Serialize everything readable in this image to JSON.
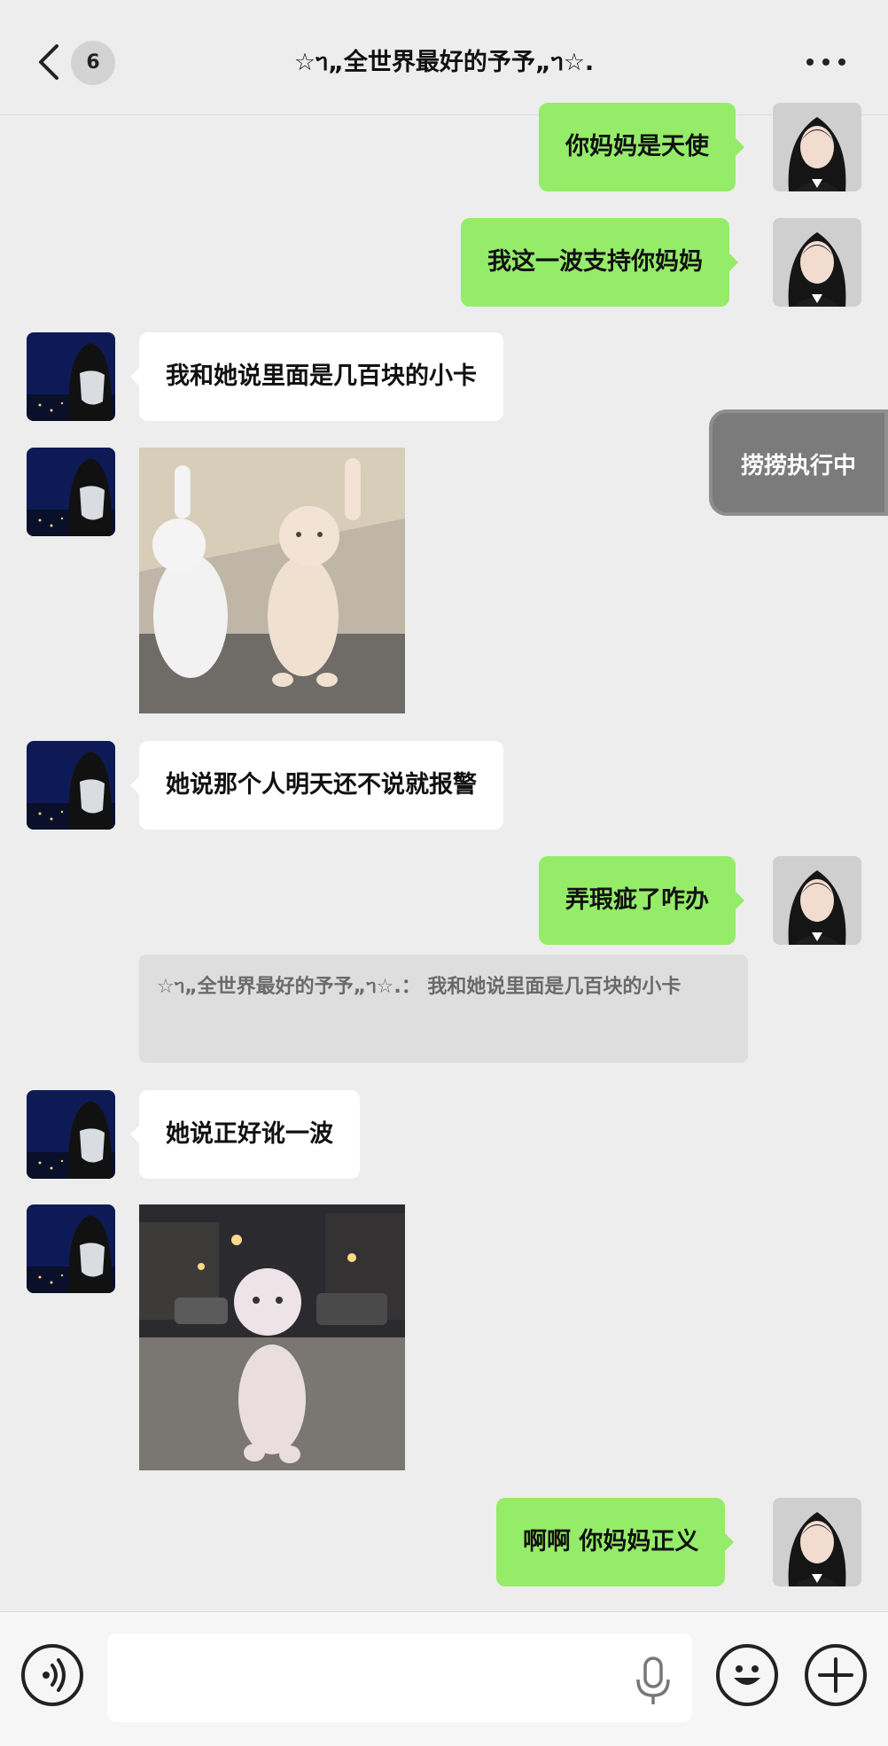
{
  "header": {
    "unread_count": "6",
    "title": "☆ᥐ„全世界最好的予予„ᥐ☆."
  },
  "messages": [
    {
      "side": "out",
      "type": "text",
      "text": "你妈妈是天使"
    },
    {
      "side": "out",
      "type": "text",
      "text": "我这一波支持你妈妈"
    },
    {
      "side": "in",
      "type": "text",
      "text": "我和她说里面是几百块的小卡"
    },
    {
      "side": "in",
      "type": "sticker",
      "sticker": "two-kittens-waving"
    },
    {
      "side": "in",
      "type": "text",
      "text": "她说那个人明天还不说就报警"
    },
    {
      "side": "out",
      "type": "text",
      "text": "弄瑕疵了咋办"
    },
    {
      "side": "in",
      "type": "quote",
      "text": "☆ᥐ„全世界最好的予予„ᥐ☆.： 我和她说里面是几百块的小卡"
    },
    {
      "side": "in",
      "type": "text",
      "text": "她说正好讹一波"
    },
    {
      "side": "in",
      "type": "sticker",
      "sticker": "kitten-walking-street"
    },
    {
      "side": "out",
      "type": "text",
      "text": "啊啊   你妈妈正义"
    }
  ],
  "floating_button": {
    "label": "捞捞执行中"
  },
  "input_bar": {
    "placeholder": ""
  },
  "colors": {
    "outgoing_bubble": "#95ec69",
    "incoming_bubble": "#ffffff",
    "background": "#ededed"
  }
}
